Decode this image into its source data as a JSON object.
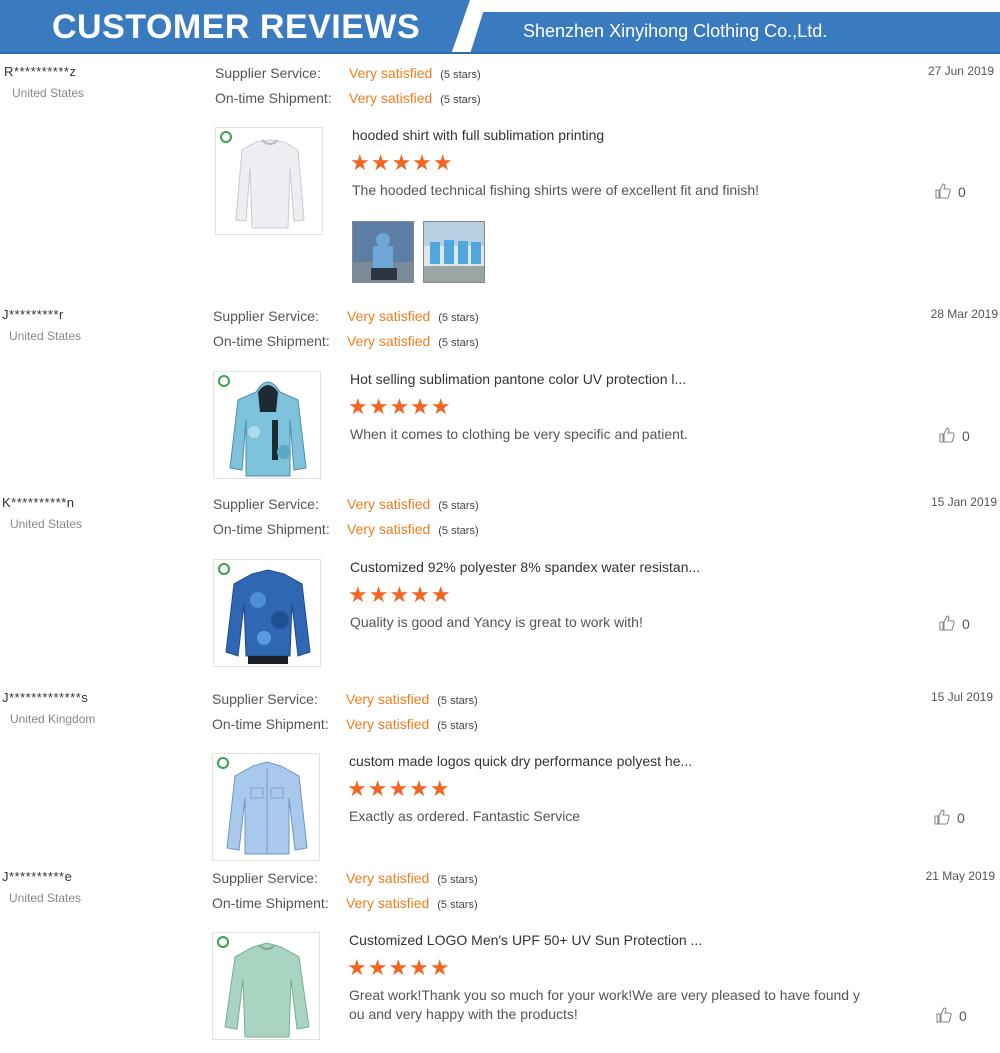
{
  "banner": {
    "title": "CUSTOMER REVIEWS",
    "company": "Shenzhen Xinyihong Clothing Co.,Ltd."
  },
  "colors": {
    "banner_blue": "#3a7bc0",
    "accent_orange": "#f07c1e",
    "star_orange": "#f26522"
  },
  "labels": {
    "supplier_service": "Supplier Service:",
    "ontime_shipment": "On-time Shipment:",
    "rating_value": "Very satisfied",
    "rating_stars": "(5 stars)"
  },
  "reviews": [
    {
      "reviewer": "R**********z",
      "country": "United States",
      "date": "27 Jun 2019",
      "product_title": "hooded shirt with full sublimation printing",
      "stars": "★★★★★",
      "comment": "The hooded technical fishing shirts were of excellent fit and finish!",
      "likes": "0",
      "thumb_icon": "white-long-sleeve-shirt"
    },
    {
      "reviewer": "J*********r",
      "country": "United States",
      "date": "28 Mar 2019",
      "product_title": "Hot selling sublimation pantone color UV protection l...",
      "stars": "★★★★★",
      "comment": "When it comes to clothing be very specific and patient.",
      "likes": "0",
      "thumb_icon": "camo-hoodie"
    },
    {
      "reviewer": "K**********n",
      "country": "United States",
      "date": "15 Jan 2019",
      "product_title": "Customized 92% polyester 8% spandex water resistan...",
      "stars": "★★★★★",
      "comment": "Quality is good and Yancy is great to work with!",
      "likes": "0",
      "thumb_icon": "blue-camo-shirt"
    },
    {
      "reviewer": "J*************s",
      "country": "United Kingdom",
      "date": "15 Jul 2019",
      "product_title": "custom made logos quick dry performance polyest he...",
      "stars": "★★★★★",
      "comment": "Exactly as ordered. Fantastic Service",
      "likes": "0",
      "thumb_icon": "light-blue-button-shirt"
    },
    {
      "reviewer": "J**********e",
      "country": "United States",
      "date": "21 May 2019",
      "product_title": "Customized LOGO Men's UPF 50+ UV Sun Protection ...",
      "stars": "★★★★★",
      "comment": "Great work!Thank you so much for your work!We are very pleased to have found y ou and very happy with the products!",
      "likes": "0",
      "thumb_icon": "mint-long-sleeve-shirt"
    }
  ]
}
